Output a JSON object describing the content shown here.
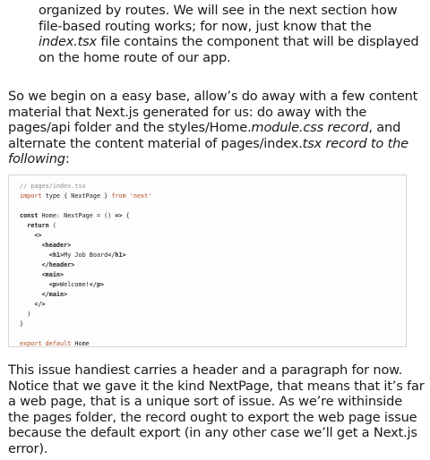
{
  "paragraph1": {
    "before": "organized by routes. We will see in the next section how file-based routing works; for now, just know that the ",
    "file": "index.tsx",
    "after": " file contains the component that will be displayed on the home route of our app."
  },
  "paragraph2": {
    "t1": "So we begin on a easy base, allow’s do away with a few content material that Next.js generated for us: do away with the pages/api folder and the styles/Home.",
    "t2": "module.css record",
    "t3": ", and alternate the content material of pages/index.",
    "t4": "tsx record to the following",
    "t5": ":"
  },
  "code": {
    "comment": "// pages/index.tsx",
    "import_kw": "import",
    "import_rest": " type { NextPage } ",
    "from_kw": "from",
    "import_src": "'next'",
    "const_kw": "const",
    "decl_rest": " Home: NextPage = () ",
    "arrow": "=>",
    "open_brace": " {",
    "indent2": "  ",
    "return_kw": "return",
    "return_paren": " (",
    "indent4": "    ",
    "frag_open": "<>",
    "indent6": "      ",
    "header_open": "<header>",
    "indent8": "        ",
    "h1_open": "<h1>",
    "h1_text": "My Job Board",
    "h1_close": "</h1>",
    "header_close": "</header>",
    "main_open": "<main>",
    "p_open": "<p>",
    "p_text": "Welcome!",
    "p_close": "</p>",
    "main_close": "</main>",
    "frag_close": "</>",
    "close_paren": ")",
    "close_brace": "}",
    "export_kw": "export default",
    "export_name": " Home"
  },
  "paragraph3": "This issue handiest carries a header and a paragraph for now. Notice that we gave it the kind NextPage, that means that it’s far a web page, that is a unique sort of issue. As we’re withinside the pages folder, the record ought to export the web page issue because the default export (in any other case we’ll get a Next.js error)."
}
